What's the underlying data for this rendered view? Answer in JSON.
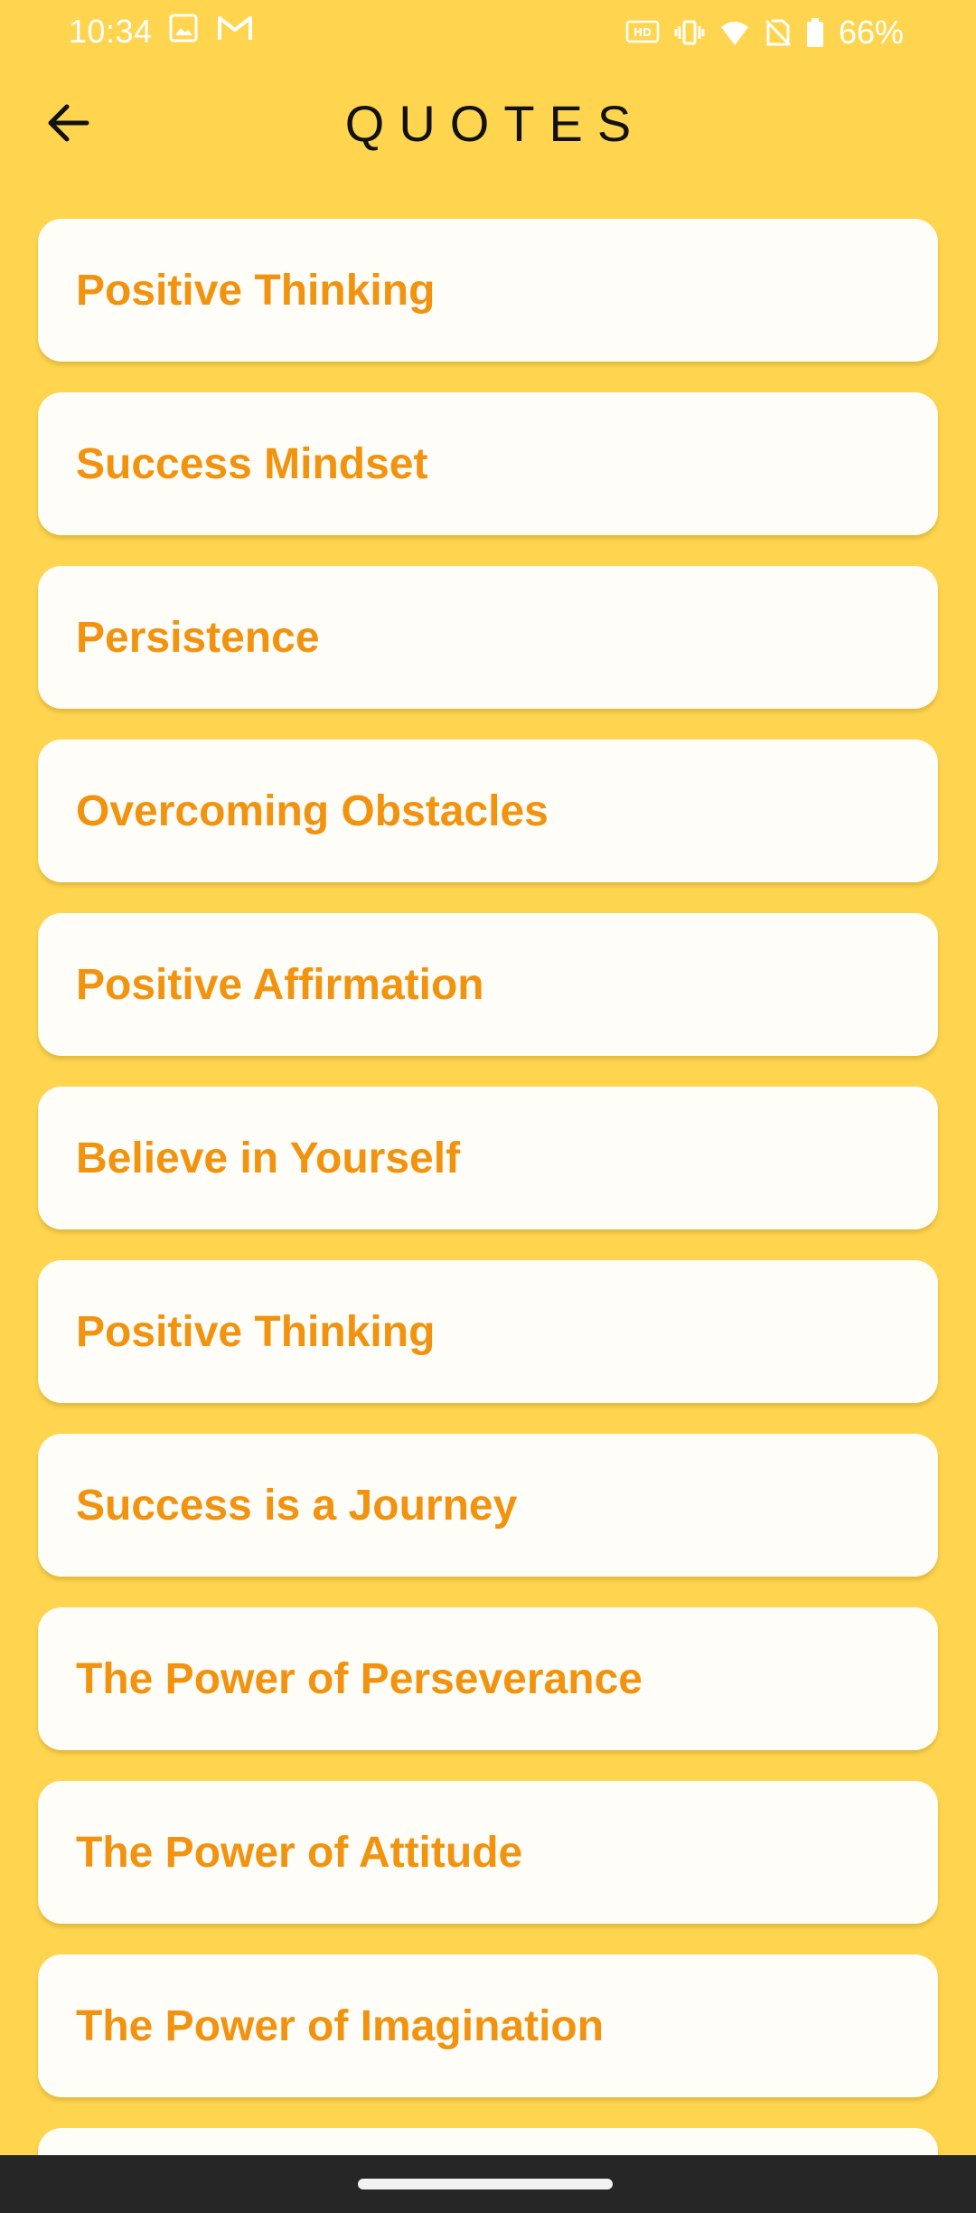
{
  "status_bar": {
    "time": "10:34",
    "battery": "66%",
    "left_icons": [
      "image-icon",
      "gmail-icon"
    ],
    "right_icons": [
      "hd-voice-icon",
      "vibrate-icon",
      "wifi-icon",
      "no-sim-icon",
      "battery-icon"
    ]
  },
  "header": {
    "title": "QUOTES",
    "back_icon": "arrow-left-icon"
  },
  "quotes": {
    "items": [
      {
        "label": "Positive Thinking"
      },
      {
        "label": "Success Mindset"
      },
      {
        "label": "Persistence"
      },
      {
        "label": "Overcoming Obstacles"
      },
      {
        "label": "Positive Affirmation"
      },
      {
        "label": "Believe in Yourself"
      },
      {
        "label": "Positive Thinking"
      },
      {
        "label": "Success is a Journey"
      },
      {
        "label": "The Power of Perseverance"
      },
      {
        "label": "The Power of Attitude"
      },
      {
        "label": "The Power of Imagination"
      }
    ]
  },
  "colors": {
    "background": "#FFD54F",
    "card": "#FFFDF7",
    "accent_text": "#F29310",
    "title_text": "#111111",
    "nav_bar": "#262626"
  }
}
